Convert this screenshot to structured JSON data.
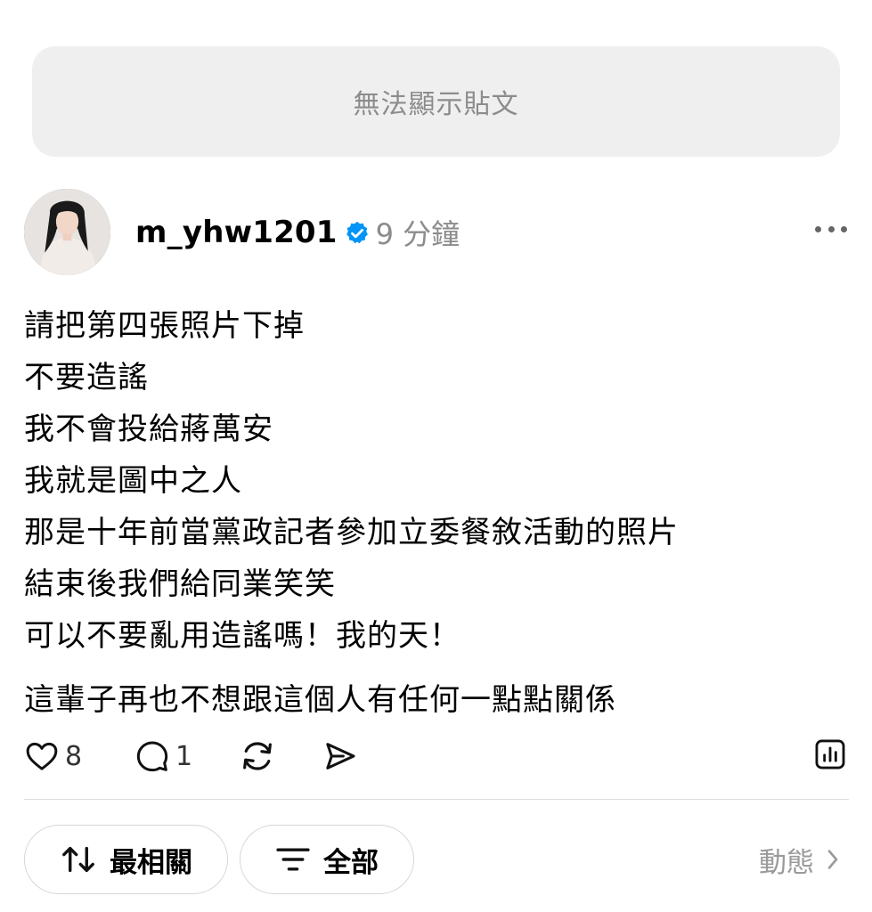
{
  "notice": {
    "text": "無法顯示貼文"
  },
  "post": {
    "username": "m_yhw1201",
    "verified": true,
    "time": "9 分鐘",
    "lines": [
      "請把第四張照片下掉",
      "不要造謠",
      "我不會投給蔣萬安",
      "我就是圖中之人",
      "那是十年前當黨政記者參加立委餐敘活動的照片",
      "結束後我們給同業笑笑",
      "可以不要亂用造謠嗎！我的天！",
      "這輩子再也不想跟這個人有任何一點點關係"
    ],
    "likes": "8",
    "comments": "1"
  },
  "icons": {
    "verified": "verified-badge-icon",
    "more": "more-dots-icon",
    "like": "heart-icon",
    "comment": "comment-bubble-icon",
    "repost": "repost-icon",
    "share": "send-icon",
    "insights": "insights-chart-icon",
    "sort": "sort-arrows-icon",
    "filter": "filter-lines-icon",
    "chevron": "chevron-right-icon"
  },
  "filters": {
    "sort_label": "最相關",
    "all_label": "全部",
    "activity_label": "動態"
  },
  "colors": {
    "verified_blue": "#0095f6",
    "muted_text": "#8c8c8c",
    "notice_bg": "#efefef"
  }
}
